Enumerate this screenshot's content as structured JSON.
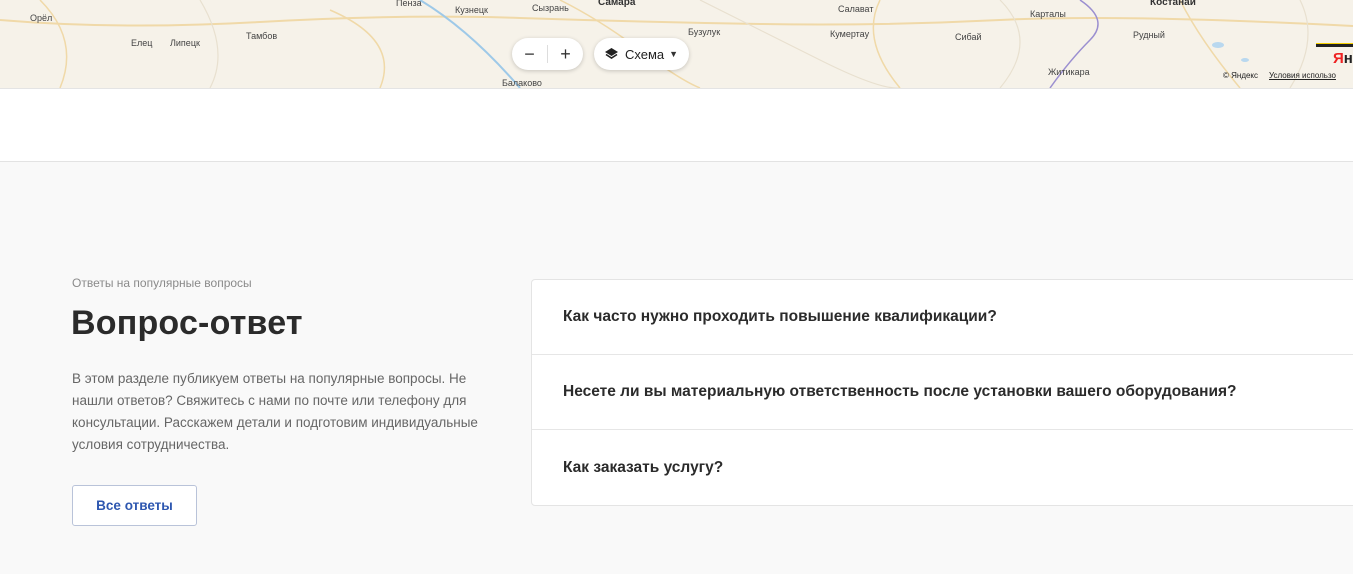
{
  "map": {
    "cities": [
      {
        "name": "Орёл",
        "big": false
      },
      {
        "name": "Елец",
        "big": false
      },
      {
        "name": "Липецк",
        "big": false
      },
      {
        "name": "Тамбов",
        "big": false
      },
      {
        "name": "Пенза",
        "big": false
      },
      {
        "name": "Кузнецк",
        "big": false
      },
      {
        "name": "Сызрань",
        "big": false
      },
      {
        "name": "Самара",
        "big": true
      },
      {
        "name": "Бузулук",
        "big": false
      },
      {
        "name": "Балаково",
        "big": false
      },
      {
        "name": "Салават",
        "big": false
      },
      {
        "name": "Кумертау",
        "big": false
      },
      {
        "name": "Сибай",
        "big": false
      },
      {
        "name": "Карталы",
        "big": false
      },
      {
        "name": "Костанай",
        "big": false
      },
      {
        "name": "Рудный",
        "big": false
      },
      {
        "name": "Житикара",
        "big": false
      }
    ],
    "zoom_out_label": "−",
    "zoom_in_label": "+",
    "layer_label": "Схема",
    "copyright": "© Яндекс",
    "terms": "Условия использо",
    "logo_red": "Я",
    "logo_dark": "н"
  },
  "faq": {
    "eyebrow": "Ответы на популярные вопросы",
    "title": "Вопрос-ответ",
    "intro": "В этом разделе публикуем ответы на популярные вопросы. Не нашли ответов? Свяжитесь с нами по почте или телефону для консультации. Расскажем детали и подготовим индивидуальные условия сотрудничества.",
    "all_button": "Все ответы",
    "questions": [
      "Как часто нужно проходить повышение квалификации?",
      "Несете ли вы материальную ответственность после установки вашего оборудования?",
      "Как заказать услугу?"
    ]
  },
  "colors": {
    "accent": "#2e57b0",
    "map_bg": "#f6f2e9",
    "section_bg": "#f9f9f9"
  }
}
